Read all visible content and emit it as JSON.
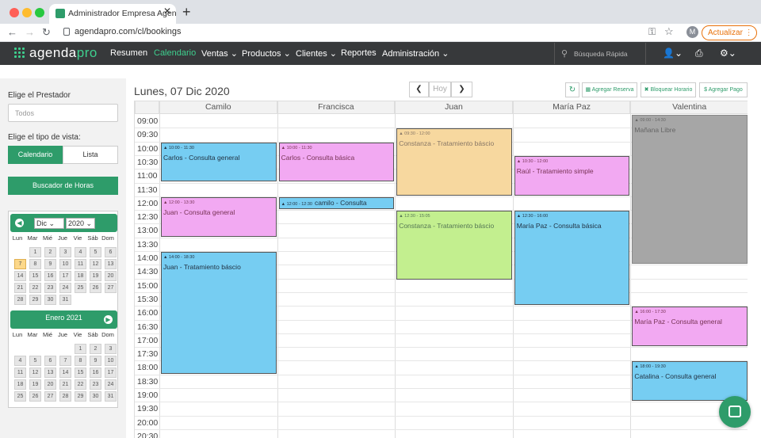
{
  "browser": {
    "tab_title": "Administrador Empresa Agenda",
    "url": "agendapro.com/cl/bookings",
    "profile_initial": "M",
    "update_label": "Actualizar"
  },
  "app": {
    "logo_main": "agenda",
    "logo_accent": "pro",
    "nav": [
      {
        "label": "Resumen"
      },
      {
        "label": "Calendario",
        "active": true
      },
      {
        "label": "Ventas"
      },
      {
        "label": "Productos"
      },
      {
        "label": "Clientes"
      },
      {
        "label": "Reportes"
      },
      {
        "label": "Administración"
      }
    ],
    "search_placeholder": "Búsqueda Rápida"
  },
  "sidebar": {
    "provider_label": "Elige el Prestador",
    "provider_value": "Todos",
    "view_label": "Elige el tipo de vista:",
    "view_calendar": "Calendario",
    "view_list": "Lista",
    "hours_button": "Buscador de Horas",
    "cal1": {
      "month": "Dic",
      "year": "2020"
    },
    "cal2": {
      "title": "Enero 2021"
    },
    "weekdays": [
      "Lun",
      "Mar",
      "Mié",
      "Jue",
      "Vie",
      "Sáb",
      "Dom"
    ],
    "today": "7"
  },
  "calendar": {
    "date_title": "Lunes, 07 Dic 2020",
    "today_label": "Hoy",
    "actions": {
      "add_booking": "Agregar Reserva",
      "block_hour": "Bloquear Horario",
      "add_payment": "Agregar Pago"
    },
    "columns": [
      "Camilo",
      "Francisca",
      "Juan",
      "María Paz",
      "Valentina"
    ],
    "times": [
      "09:00",
      "09:30",
      "10:00",
      "10:30",
      "11:00",
      "11:30",
      "12:00",
      "12:30",
      "13:00",
      "13:30",
      "14:00",
      "14:30",
      "15:00",
      "15:30",
      "16:00",
      "16:30",
      "17:00",
      "17:30",
      "18:00",
      "18:30",
      "19:00",
      "19:30",
      "20:00",
      "20:30"
    ],
    "events": [
      {
        "col": 0,
        "start": "10:00",
        "end": "11:30",
        "time": "10:00 - 11:30",
        "title": "Carlos - Consulta general",
        "color": "blue"
      },
      {
        "col": 0,
        "start": "12:00",
        "end": "13:30",
        "time": "12:00 - 13:30",
        "title": "Juan - Consulta general",
        "color": "pink"
      },
      {
        "col": 0,
        "start": "14:00",
        "end": "18:30",
        "time": "14:00 - 18:30",
        "title": "Juan - Tratamiento báscio",
        "color": "blue"
      },
      {
        "col": 1,
        "start": "10:00",
        "end": "11:30",
        "time": "10:00 - 11:30",
        "title": "Carlos - Consulta básica",
        "color": "pink"
      },
      {
        "col": 1,
        "start": "12:00",
        "end": "12:30",
        "time": "12:00 - 12:30",
        "title": "camilo - Consulta",
        "color": "blue",
        "inline": true
      },
      {
        "col": 2,
        "start": "09:30",
        "end": "12:00",
        "time": "09:30 - 12:00",
        "title": "Constanza - Tratamiento báscio",
        "color": "orange"
      },
      {
        "col": 2,
        "start": "12:30",
        "end": "15:05",
        "time": "12:30 - 15:05",
        "title": "Constanza - Tratamiento báscio",
        "color": "green"
      },
      {
        "col": 3,
        "start": "10:30",
        "end": "12:00",
        "time": "10:30 - 12:00",
        "title": "Raúl - Tratamiento simple",
        "color": "pink"
      },
      {
        "col": 3,
        "start": "12:30",
        "end": "16:00",
        "time": "12:30 - 16:00",
        "title": "María Paz - Consulta básica",
        "color": "blue"
      },
      {
        "col": 4,
        "start": "09:00",
        "end": "14:30",
        "time": "09:00 - 14:30",
        "title": "Mañana Libre",
        "color": "gray"
      },
      {
        "col": 4,
        "start": "16:00",
        "end": "17:30",
        "time": "16:00 - 17:30",
        "title": "María Paz - Consulta general",
        "color": "pink"
      },
      {
        "col": 4,
        "start": "18:00",
        "end": "19:30",
        "time": "18:00 - 19:30",
        "title": "Catalina - Consulta general",
        "color": "blue"
      }
    ]
  }
}
